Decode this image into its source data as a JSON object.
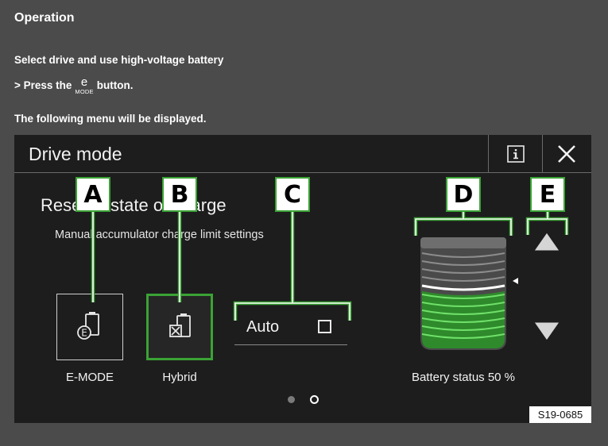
{
  "doc": {
    "heading": "Operation",
    "subheading": "Select drive and use high-voltage battery",
    "step": {
      "prefix": "> Press the",
      "mode_glyph_letter": "e",
      "mode_glyph_word": "MODE",
      "suffix": "button."
    },
    "paragraph": "The following menu will be displayed."
  },
  "screen": {
    "title": "Drive mode",
    "info_icon": "info-icon",
    "close_icon": "close-icon",
    "section_title": "Reserve state of charge",
    "section_subtitle": "Manual accumulator charge limit settings",
    "modes": [
      {
        "label": "E-MODE",
        "icon": "e-mode-battery-icon",
        "selected": false
      },
      {
        "label": "Hybrid",
        "icon": "hybrid-battery-icon",
        "selected": true
      }
    ],
    "auto": {
      "label": "Auto",
      "checked": false
    },
    "battery": {
      "status_label": "Battery status 50 %",
      "level_percent": 50
    },
    "pagination": {
      "count": 2,
      "active_index": 1
    }
  },
  "callouts": [
    "A",
    "B",
    "C",
    "D",
    "E"
  ],
  "figure_code": "S19-0685",
  "colors": {
    "accent_green": "#3aa335",
    "screen_bg": "#1d1d1d",
    "page_bg": "#4b4b4b"
  }
}
